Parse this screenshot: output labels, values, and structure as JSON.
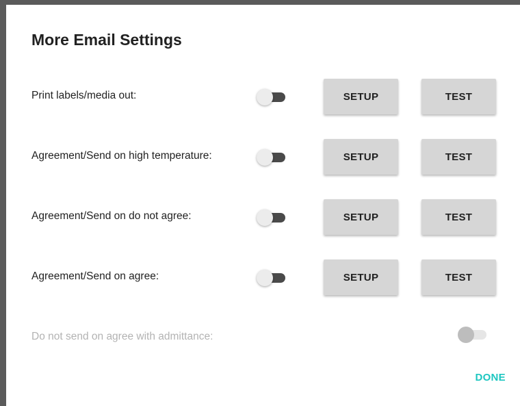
{
  "dialog": {
    "title": "More Email Settings",
    "rows": [
      {
        "label": "Print labels/media out:",
        "toggle_on": false,
        "setup_label": "SETUP",
        "test_label": "TEST"
      },
      {
        "label": "Agreement/Send on high temperature:",
        "toggle_on": false,
        "setup_label": "SETUP",
        "test_label": "TEST"
      },
      {
        "label": "Agreement/Send on do not agree:",
        "toggle_on": false,
        "setup_label": "SETUP",
        "test_label": "TEST"
      },
      {
        "label": "Agreement/Send on agree:",
        "toggle_on": false,
        "setup_label": "SETUP",
        "test_label": "TEST"
      }
    ],
    "disabled_option": {
      "label": "Do not send on agree with admittance:",
      "toggle_on": false,
      "enabled": false
    },
    "done_label": "DONE"
  },
  "colors": {
    "accent": "#1cc6c0",
    "button_bg": "#d6d6d6",
    "text": "#212121",
    "disabled_text": "#b3b3b3"
  },
  "icons": [
    "toggle-switch-icon"
  ]
}
